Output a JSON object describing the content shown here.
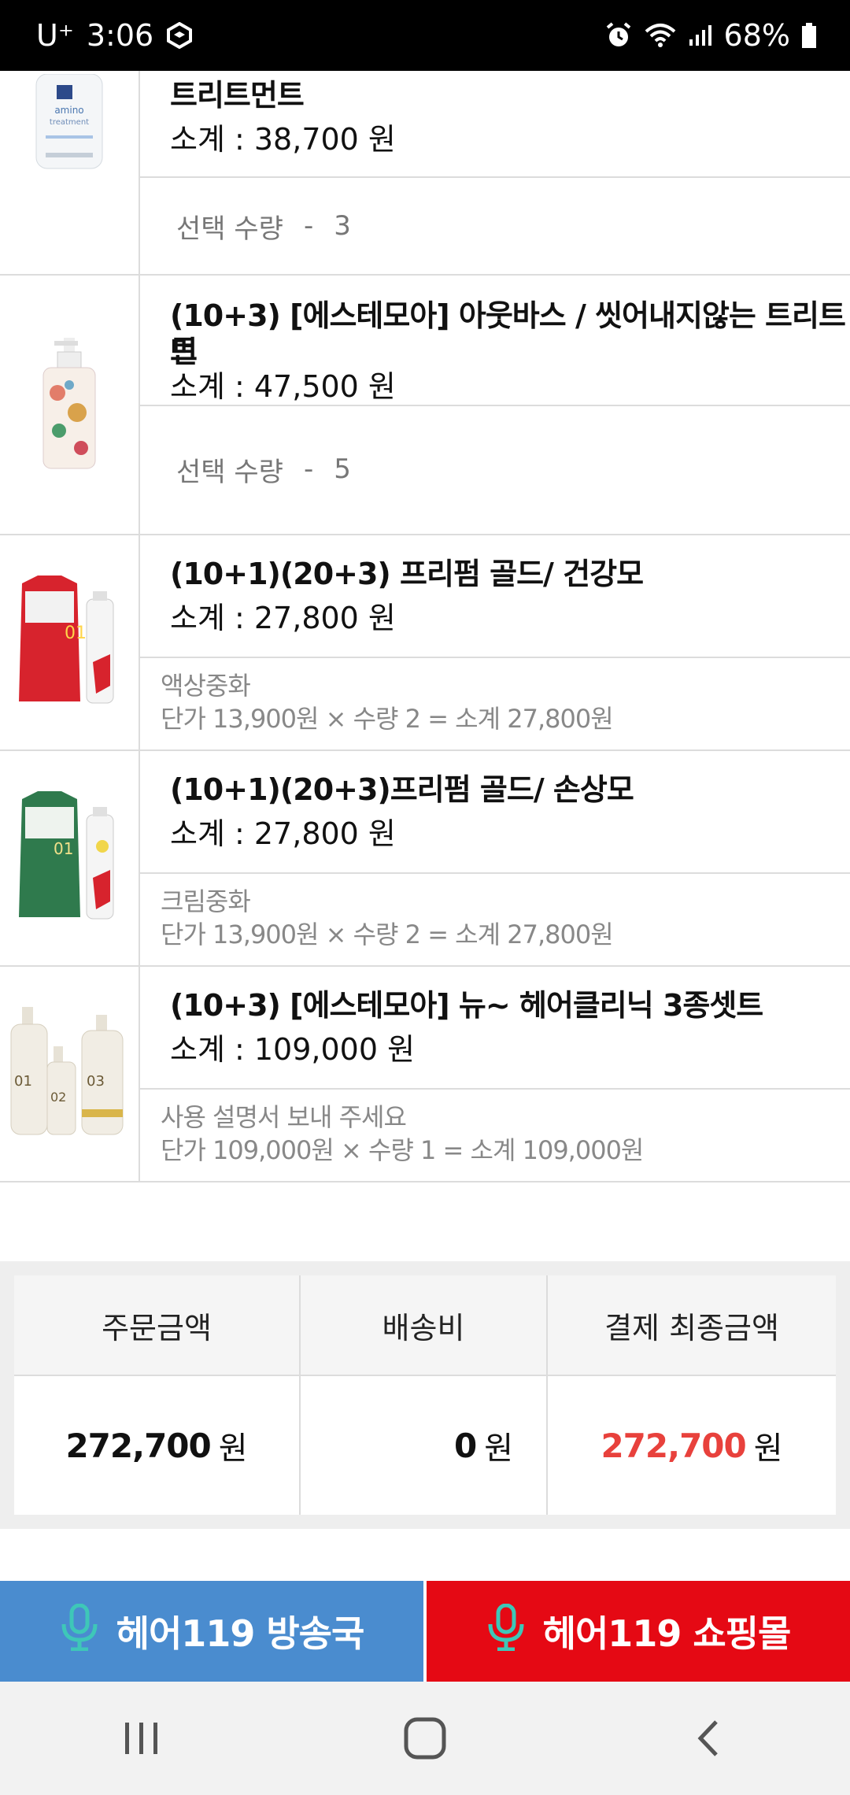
{
  "status_bar": {
    "carrier": "U⁺",
    "time": "3:06",
    "battery": "68%"
  },
  "products": [
    {
      "name": "트리트먼트",
      "subtotal": "소계 : 38,700 원",
      "qty_label": "선택 수량",
      "qty_sep": "-",
      "qty": "3",
      "thumb": "white-bottle-icon"
    },
    {
      "name_line1": "(10+3) [에스테모아] 아웃바스 / 씻어내지않는 트리트먼",
      "name_line2": "트",
      "subtotal": "소계 : 47,500 원",
      "qty_label": "선택 수량",
      "qty_sep": "-",
      "qty": "5",
      "thumb": "floral-pump-bottle-icon"
    },
    {
      "name": "(10+1)(20+3) 프리펌 골드/ 건강모",
      "subtotal": "소계 : 27,800 원",
      "option": "액상중화",
      "detail": "단가 13,900원 × 수량 2 = 소계 27,800원",
      "thumb": "red-pouch-icon"
    },
    {
      "name": "(10+1)(20+3)프리펌 골드/ 손상모",
      "subtotal": "소계 : 27,800 원",
      "option": "크림중화",
      "detail": "단가 13,900원 × 수량 2 = 소계 27,800원",
      "thumb": "green-pouch-icon"
    },
    {
      "name": "(10+3) [에스테모아] 뉴~ 헤어클리닉 3종셋트",
      "subtotal": "소계 : 109,000 원",
      "option": "사용 설명서 보내 주세요",
      "detail": "단가 109,000원 × 수량 1 = 소계 109,000원",
      "thumb": "three-bottles-icon"
    }
  ],
  "summary": {
    "headers": [
      "주문금액",
      "배송비",
      "결제 최종금액"
    ],
    "order_amount": "272,700",
    "shipping": "0",
    "final_amount": "272,700",
    "unit": "원",
    "accent_color": "#e8413c"
  },
  "buttons": {
    "broadcast": "헤어119 방송국",
    "shop": "헤어119 쇼핑몰",
    "broadcast_color": "#4a8ccf",
    "shop_color": "#e50914"
  }
}
